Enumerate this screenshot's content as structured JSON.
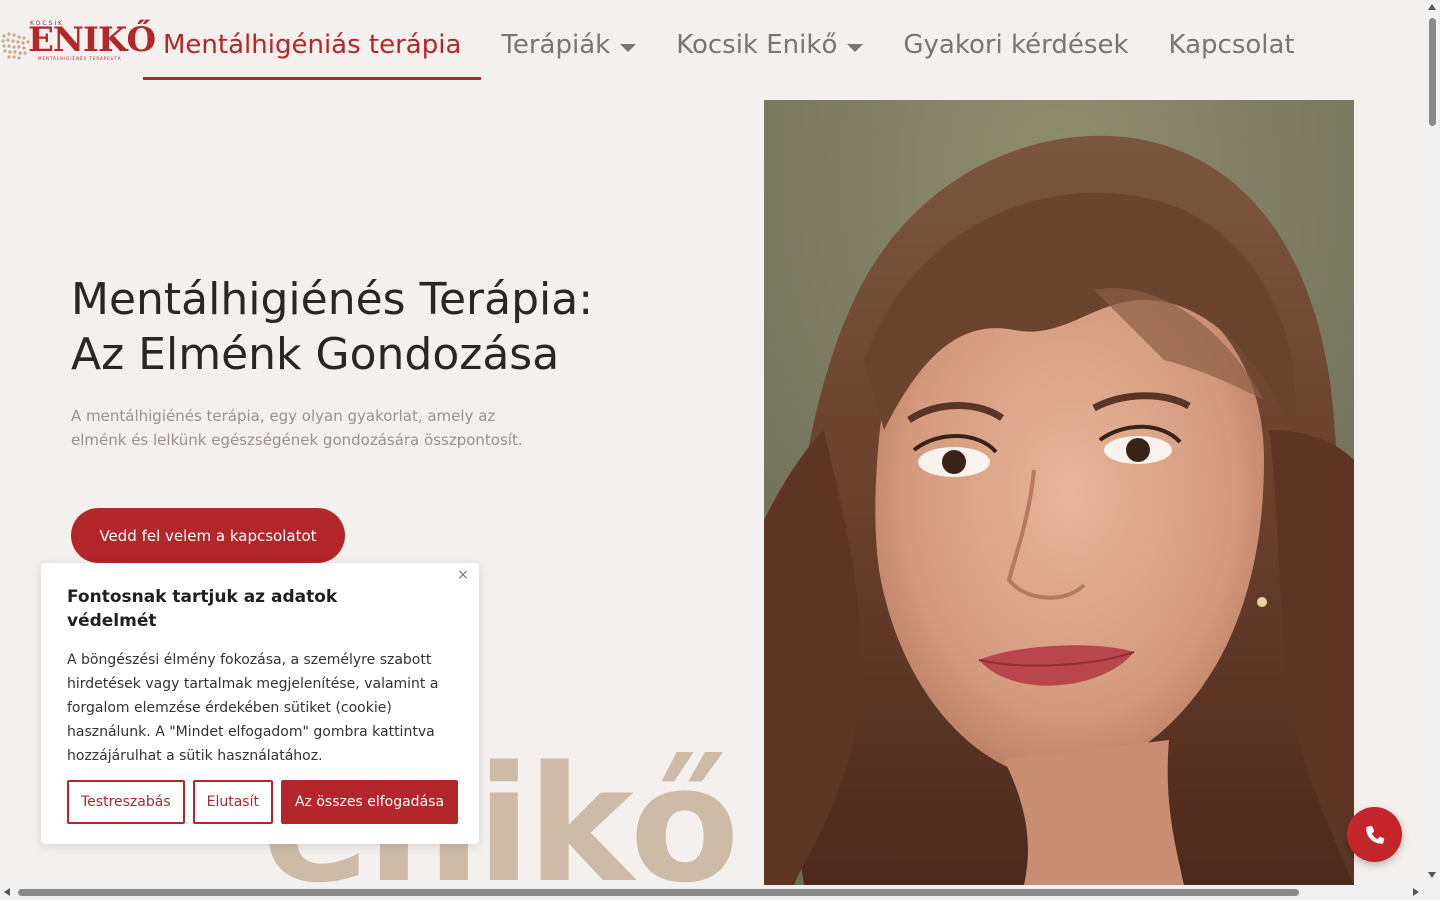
{
  "logo": {
    "top_text": "KOCSIK",
    "main_text": "ENIKŐ",
    "sub_text": "MENTÁLHIGIÉNÉS TERAPEUTA"
  },
  "nav": {
    "items": [
      {
        "label": "Mentálhigéniás terápia",
        "active": true,
        "has_dropdown": false
      },
      {
        "label": "Terápiák",
        "active": false,
        "has_dropdown": true
      },
      {
        "label": "Kocsik Enikő",
        "active": false,
        "has_dropdown": true
      },
      {
        "label": "Gyakori kérdések",
        "active": false,
        "has_dropdown": false
      },
      {
        "label": "Kapcsolat",
        "active": false,
        "has_dropdown": false
      }
    ]
  },
  "hero": {
    "title_line1": "Mentálhigiénés Terápia:",
    "title_line2": "Az Elménk Gondozása",
    "description": "A mentálhigiénés terápia, egy olyan gyakorlat, amely az elménk és lelkünk egészségének gondozására összpontosít.",
    "cta_label": "Vedd fel velem a kapcsolatot",
    "background_word": "enikő"
  },
  "cookie": {
    "title": "Fontosnak tartjuk az adatok védelmét",
    "text": "A böngészési élmény fokozása, a személyre szabott hirdetések vagy tartalmak megjelenítése, valamint a forgalom elemzése érdekében sütiket (cookie) használunk. A \"Mindet elfogadom\" gombra kattintva hozzájárulhat a sütik használatához.",
    "close_glyph": "×",
    "customize_label": "Testreszabás",
    "reject_label": "Elutasít",
    "accept_all_label": "Az összes elfogadása"
  },
  "icons": {
    "phone": "phone-icon",
    "close": "close-icon",
    "caret": "caret-down-icon"
  },
  "colors": {
    "brand": "#b3262a",
    "background": "#f3f0ed",
    "nav_text": "#7c7470",
    "title_text": "#2b2624",
    "muted_text": "#9a918c",
    "background_word": "#cdbba8"
  }
}
